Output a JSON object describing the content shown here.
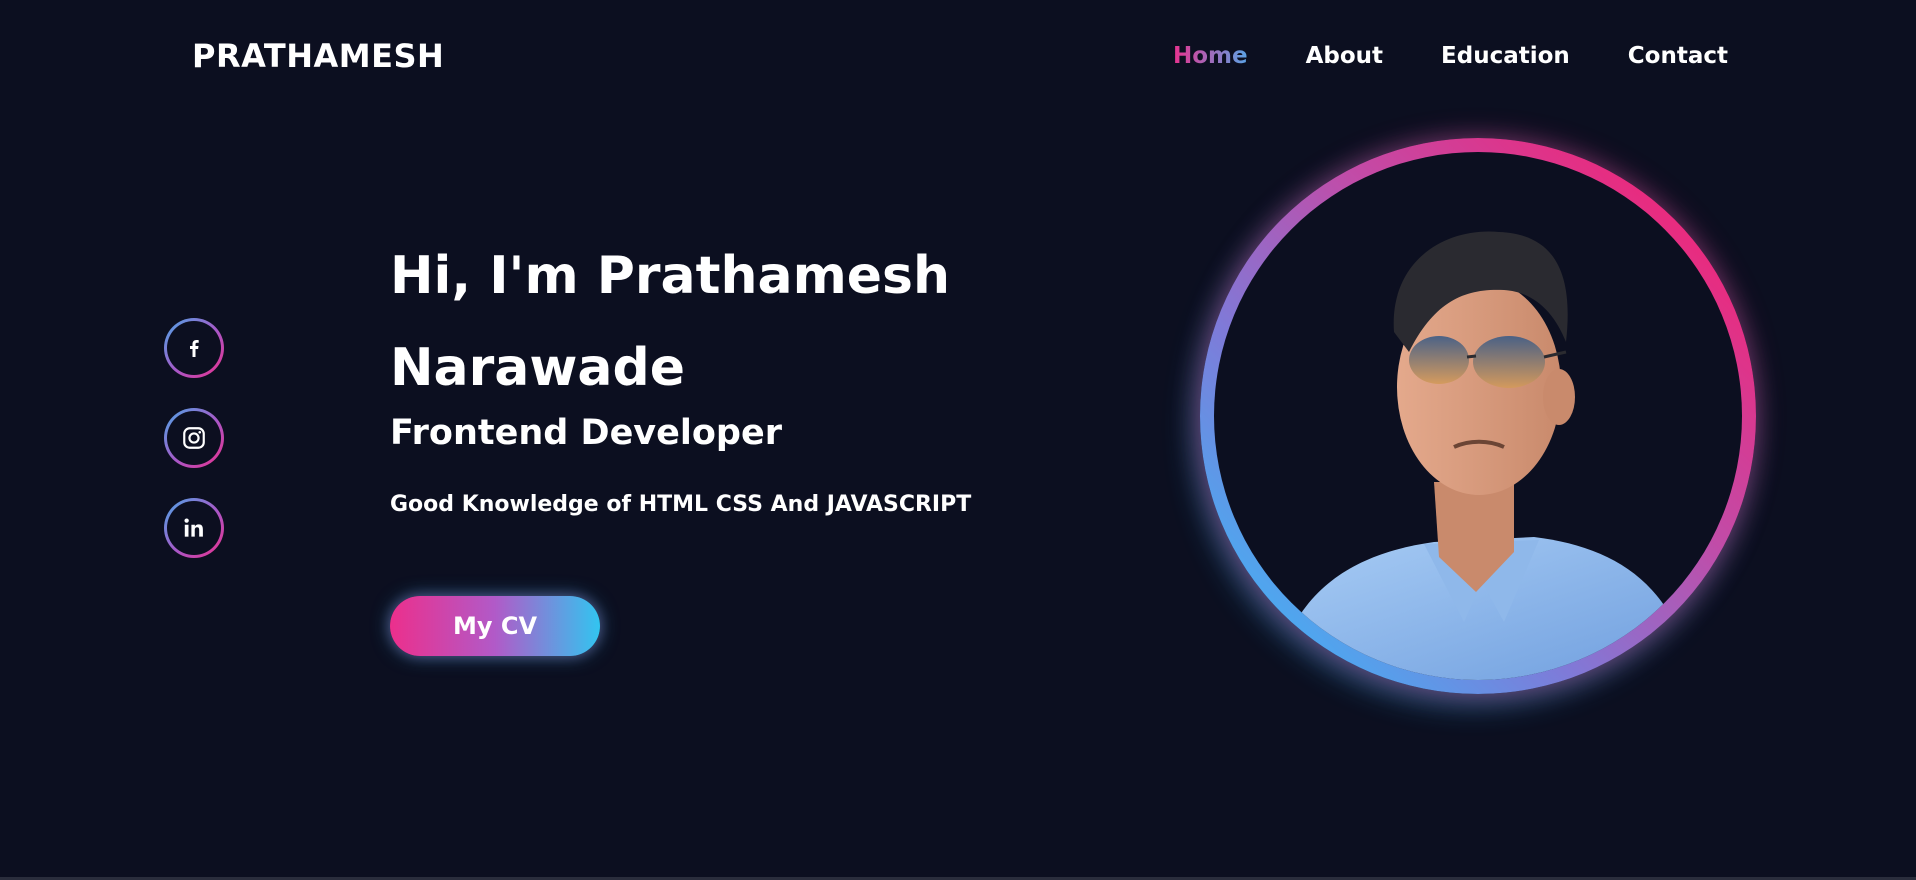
{
  "header": {
    "logo": "PRATHAMESH",
    "nav": [
      {
        "label": "Home",
        "active": true
      },
      {
        "label": "About",
        "active": false
      },
      {
        "label": "Education",
        "active": false
      },
      {
        "label": "Contact",
        "active": false
      }
    ]
  },
  "social": [
    {
      "name": "facebook-icon",
      "glyph": "f"
    },
    {
      "name": "instagram-icon",
      "glyph": "instagram"
    },
    {
      "name": "linkedin-icon",
      "glyph": "in"
    }
  ],
  "hero": {
    "greeting": "Hi, I'm Prathamesh Narawade",
    "role": "Frontend Developer",
    "tagline": "Good Knowledge of HTML CSS And JAVASCRIPT",
    "cv_button": "My CV"
  },
  "colors": {
    "background": "#0c0f20",
    "accent_pink": "#ec2f8c",
    "accent_blue": "#32c5f0",
    "ring_red": "#ff1867"
  }
}
